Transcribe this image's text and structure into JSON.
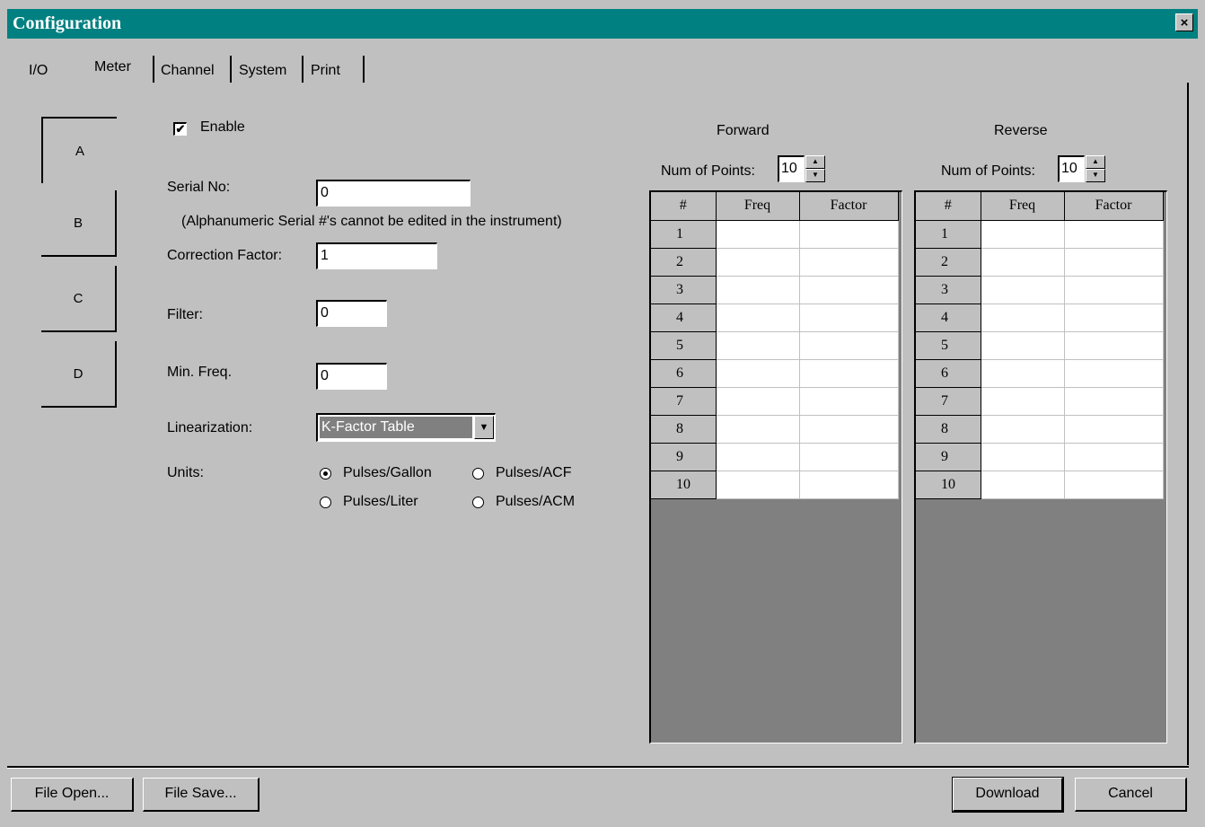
{
  "window": {
    "title": "Configuration",
    "close_glyph": "×"
  },
  "tabs": [
    {
      "label": "I/O"
    },
    {
      "label": "Meter"
    },
    {
      "label": "Channel"
    },
    {
      "label": "System"
    },
    {
      "label": "Print"
    }
  ],
  "meters": [
    {
      "label": "A",
      "selected": true
    },
    {
      "label": "B"
    },
    {
      "label": "C"
    },
    {
      "label": "D"
    }
  ],
  "form": {
    "enable_label": "Enable",
    "enable_checked": true,
    "serial_label": "Serial No:",
    "serial_value": "0",
    "serial_note": "(Alphanumeric Serial #'s cannot be edited in the instrument)",
    "correction_label": "Correction Factor:",
    "correction_value": "1",
    "filter_label": "Filter:",
    "filter_value": "0",
    "minfreq_label": "Min. Freq.",
    "minfreq_value": "0",
    "linearization_label": "Linearization:",
    "linearization_value": "K-Factor Table",
    "units_label": "Units:",
    "units_options": [
      {
        "label": "Pulses/Gallon",
        "selected": true
      },
      {
        "label": "Pulses/ACF",
        "selected": false
      },
      {
        "label": "Pulses/Liter",
        "selected": false
      },
      {
        "label": "Pulses/ACM",
        "selected": false
      }
    ]
  },
  "forward": {
    "title": "Forward",
    "points_label": "Num of Points:",
    "points_value": "10",
    "headers": [
      "#",
      "Freq",
      "Factor"
    ],
    "rows": [
      "1",
      "2",
      "3",
      "4",
      "5",
      "6",
      "7",
      "8",
      "9",
      "10"
    ]
  },
  "reverse": {
    "title": "Reverse",
    "points_label": "Num of Points:",
    "points_value": "10",
    "headers": [
      "#",
      "Freq",
      "Factor"
    ],
    "rows": [
      "1",
      "2",
      "3",
      "4",
      "5",
      "6",
      "7",
      "8",
      "9",
      "10"
    ]
  },
  "buttons": {
    "file_open": "File Open...",
    "file_save": "File Save...",
    "download": "Download",
    "cancel": "Cancel"
  },
  "icons": {
    "spin_up": "▲",
    "spin_down": "▼",
    "dropdown": "▼",
    "check": "✔"
  }
}
